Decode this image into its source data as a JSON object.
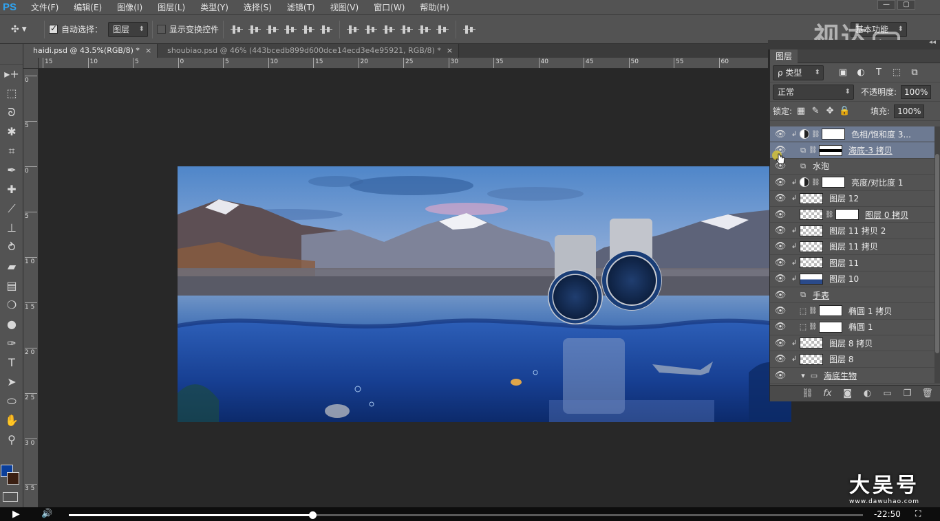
{
  "app": {
    "logo": "PS"
  },
  "menubar": [
    "文件(F)",
    "编辑(E)",
    "图像(I)",
    "图层(L)",
    "类型(Y)",
    "选择(S)",
    "滤镜(T)",
    "视图(V)",
    "窗口(W)",
    "帮助(H)"
  ],
  "options": {
    "auto_select_label": "自动选择：",
    "auto_select_checked": true,
    "auto_select_target": "图层",
    "show_transform_label": "显示变换控件",
    "show_transform_checked": false,
    "workspace": "基本功能"
  },
  "tabs": [
    {
      "label": "haidi.psd @ 43.5%(RGB/8) *",
      "active": true
    },
    {
      "label": "shoubiao.psd @ 46% (443bcedb899d600dce14ecd3e4e95921, RGB/8) *",
      "active": false
    }
  ],
  "ruler_h": [
    "15",
    "10",
    "5",
    "0",
    "5",
    "10",
    "15",
    "20",
    "25",
    "30",
    "35",
    "40",
    "45",
    "50",
    "55",
    "60"
  ],
  "ruler_v": [
    "0",
    "5",
    "0",
    "5",
    "1\n0",
    "1\n5",
    "2\n0",
    "2\n5",
    "3\n0",
    "3\n5"
  ],
  "layers_panel": {
    "title": "图层",
    "filter": "ρ 类型",
    "blend_mode": "正常",
    "opacity_label": "不透明度:",
    "opacity": "100%",
    "lock_label": "锁定:",
    "fill_label": "填充:",
    "fill": "100%",
    "layers": [
      {
        "name": "色相/饱和度 3...",
        "clip": true,
        "kind": "adj",
        "mask": "white",
        "selected": true
      },
      {
        "name": "海底-3 拷贝",
        "clip": false,
        "kind": "smart",
        "mask": "band",
        "selected": true,
        "underline": true
      },
      {
        "name": "水泡",
        "clip": false,
        "kind": "smart",
        "mask": "",
        "selected": false
      },
      {
        "name": "亮度/对比度 1",
        "clip": true,
        "kind": "adj",
        "mask": "white",
        "selected": false
      },
      {
        "name": "图层 12",
        "clip": true,
        "kind": "pixel",
        "mask": "",
        "selected": false
      },
      {
        "name": "图层 0 拷贝",
        "clip": false,
        "kind": "pixel-mask",
        "mask": "white",
        "selected": false,
        "underline": true
      },
      {
        "name": "图层 11 拷贝 2",
        "clip": true,
        "kind": "pixel",
        "mask": "",
        "selected": false
      },
      {
        "name": "图层 11 拷贝",
        "clip": true,
        "kind": "pixel",
        "mask": "",
        "selected": false
      },
      {
        "name": "图层 11",
        "clip": true,
        "kind": "pixel",
        "mask": "",
        "selected": false
      },
      {
        "name": "图层 10",
        "clip": true,
        "kind": "pixel-blue",
        "mask": "",
        "selected": false
      },
      {
        "name": "手表",
        "clip": false,
        "kind": "smart-only",
        "mask": "",
        "selected": false,
        "underline": true
      },
      {
        "name": "椭圆 1 拷贝",
        "clip": false,
        "kind": "shape",
        "mask": "white",
        "selected": false
      },
      {
        "name": "椭圆 1",
        "clip": false,
        "kind": "shape",
        "mask": "white",
        "selected": false
      },
      {
        "name": "图层 8 拷贝",
        "clip": true,
        "kind": "pixel",
        "mask": "",
        "selected": false
      },
      {
        "name": "图层 8",
        "clip": true,
        "kind": "pixel",
        "mask": "",
        "selected": false
      },
      {
        "name": "海底生物",
        "clip": false,
        "kind": "group",
        "mask": "",
        "selected": false,
        "underline": true
      }
    ]
  },
  "video": {
    "progress": 0.307,
    "time": "-22:50"
  },
  "watermarks": {
    "top_right": "视达",
    "bottom_right_main": "大吴号",
    "bottom_right_sub": "www.dawuhao.com"
  }
}
